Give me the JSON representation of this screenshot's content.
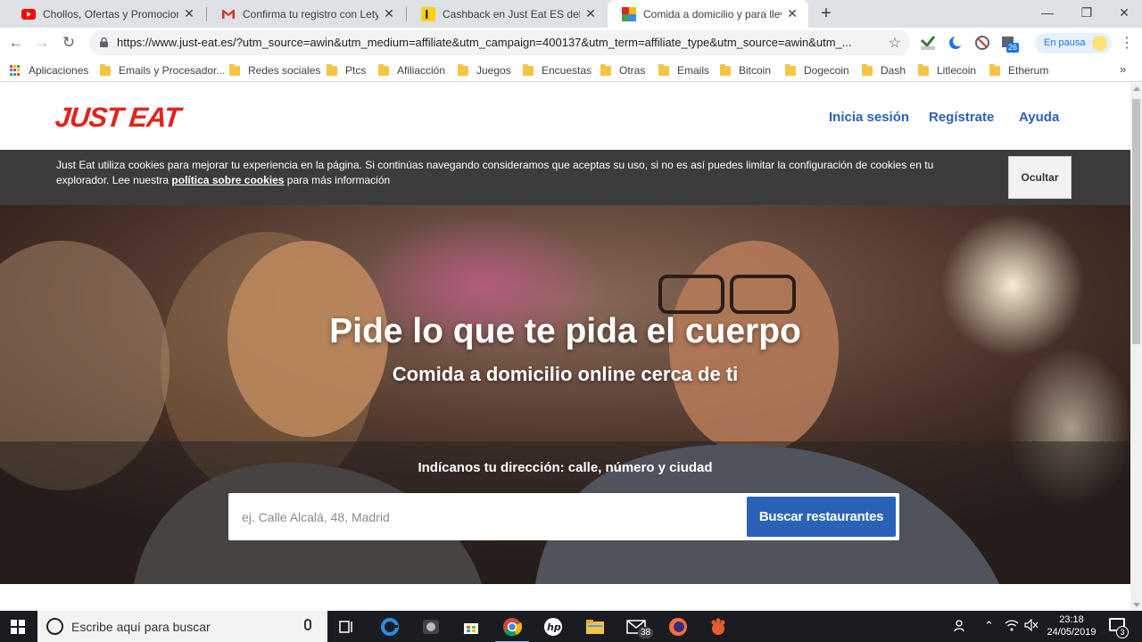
{
  "browser": {
    "tabs": [
      {
        "title": "Chollos, Ofertas y Promociones -",
        "favicon": "youtube-icon",
        "active": false
      },
      {
        "title": "Confirma tu registro con Letysho",
        "favicon": "gmail-icon",
        "active": false
      },
      {
        "title": "Cashback en Just Eat ES del servi",
        "favicon": "letyshops-icon",
        "active": false
      },
      {
        "title": "Comida a domicilio y para llevar",
        "favicon": "just-eat-favicon",
        "active": true
      }
    ],
    "new_tab": "+",
    "window_controls": {
      "minimize": "—",
      "maximize": "❐",
      "close": "✕"
    },
    "url": "https://www.just-eat.es/?utm_source=awin&utm_medium=affiliate&utm_campaign=400137&utm_term=affiliate_type&utm_source=awin&utm_...",
    "profile_pill": "En pausa",
    "extension_badge": "26",
    "bookmarks": [
      {
        "label": "Aplicaciones",
        "icon": "apps-grid-icon"
      },
      {
        "label": "Emails y Procesador...",
        "icon": "folder-icon"
      },
      {
        "label": "Redes sociales",
        "icon": "folder-icon"
      },
      {
        "label": "Ptcs",
        "icon": "folder-icon"
      },
      {
        "label": "Afiliacción",
        "icon": "folder-icon"
      },
      {
        "label": "Juegos",
        "icon": "folder-icon"
      },
      {
        "label": "Encuestas",
        "icon": "folder-icon"
      },
      {
        "label": "Otras",
        "icon": "folder-icon"
      },
      {
        "label": "Emails",
        "icon": "folder-icon"
      },
      {
        "label": "Bitcoin",
        "icon": "folder-icon"
      },
      {
        "label": "Dogecoin",
        "icon": "folder-icon"
      },
      {
        "label": "Dash",
        "icon": "folder-icon"
      },
      {
        "label": "Litlecoin",
        "icon": "folder-icon"
      },
      {
        "label": "Etherum",
        "icon": "folder-icon"
      }
    ],
    "bookmarks_more": "»"
  },
  "site": {
    "logo": "JUST EAT",
    "brand_color": "#e2231a",
    "link_color": "#2a62b8",
    "nav": {
      "login": "Inicia sesión",
      "register": "Regístrate",
      "help": "Ayuda"
    },
    "cookie": {
      "text_before": "Just Eat utiliza cookies para mejorar tu experiencia en la página. Si continúas navegando consideramos que aceptas su uso, si no es así puedes limitar la configuración de cookies en tu explorador. Lee nuestra ",
      "link": "política sobre cookies",
      "text_after": " para más información",
      "button": "Ocultar"
    },
    "hero": {
      "title": "Pide lo que te pida el cuerpo",
      "subtitle": "Comida a domicilio online cerca de ti",
      "search_label": "Indícanos tu dirección: calle, número y ciudad",
      "search_placeholder": "ej. Calle Alcalá, 48, Madrid",
      "search_value": "",
      "search_button": "Buscar restaurantes"
    }
  },
  "taskbar": {
    "search_placeholder": "Escribe aquí para buscar",
    "mail_badge": "38",
    "time": "23:18",
    "date": "24/05/2019",
    "notification_count": "3"
  }
}
